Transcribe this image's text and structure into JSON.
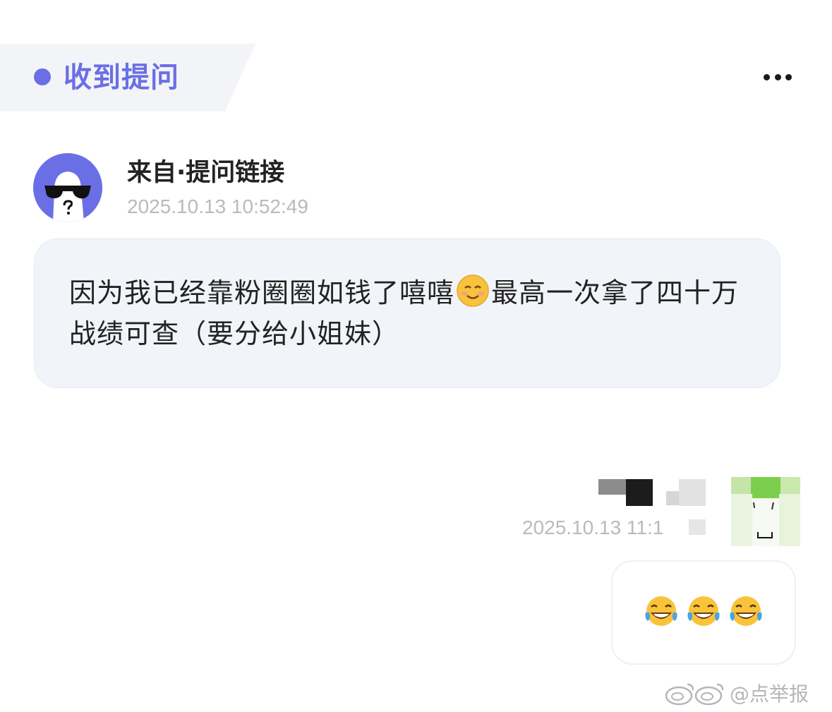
{
  "header": {
    "title": "收到提问",
    "accent_color": "#6a6fe6",
    "more_icon": "more-dots-icon"
  },
  "question": {
    "sender_name": "来自·提问链接",
    "timestamp": "2025.10.13 10:52:49",
    "text_part1": "因为我已经靠粉圈圈如钱了嘻嘻",
    "text_part2": "最高一次拿了四十万战绩可查（要分给小姐妹）",
    "emoji": "smiling-face-icon"
  },
  "reply": {
    "timestamp": "2025.10.13 11:1",
    "emojis": [
      "laughing-tears-icon",
      "laughing-tears-icon",
      "laughing-tears-icon"
    ]
  },
  "watermark": {
    "handle": "@点举报",
    "logo": "weibo-logo-icon"
  }
}
